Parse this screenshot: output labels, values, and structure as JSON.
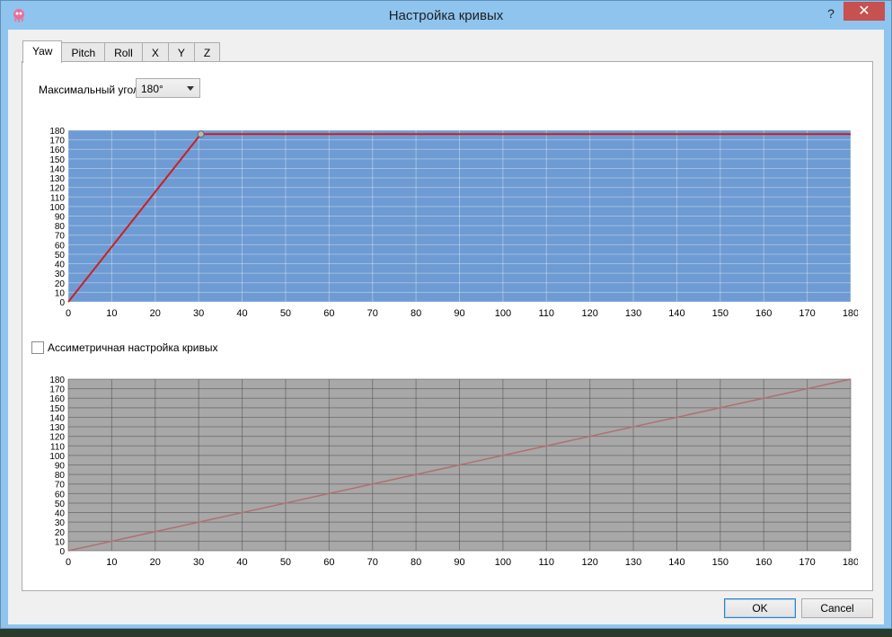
{
  "window": {
    "title": "Настройка кривых"
  },
  "titlebar": {
    "help": "?",
    "close": "✕"
  },
  "tabs": [
    "Yaw",
    "Pitch",
    "Roll",
    "X",
    "Y",
    "Z"
  ],
  "active_tab": "Yaw",
  "max_angle": {
    "label": "Максимальный угол",
    "value": "180°"
  },
  "asymmetric": {
    "label": "Ассиметричная настройка кривых",
    "checked": false
  },
  "buttons": {
    "ok": "OK",
    "cancel": "Cancel"
  },
  "colors": {
    "top_plot_bg": "#6e9bd3",
    "bottom_plot_bg": "#a8a8a8",
    "top_line": "#cc1f1f",
    "bottom_line": "#b07070"
  },
  "chart_data": [
    {
      "type": "line",
      "x_ticks": [
        0,
        10,
        20,
        30,
        40,
        50,
        60,
        70,
        80,
        90,
        100,
        110,
        120,
        130,
        140,
        150,
        160,
        170,
        180
      ],
      "y_ticks": [
        0,
        10,
        20,
        30,
        40,
        50,
        60,
        70,
        80,
        90,
        100,
        110,
        120,
        130,
        140,
        150,
        160,
        170,
        180
      ],
      "xlim": [
        0,
        180
      ],
      "ylim": [
        0,
        180
      ],
      "grid": true,
      "series": [
        {
          "x": [
            0,
            30.5,
            180
          ],
          "y": [
            0,
            176,
            176
          ]
        }
      ],
      "control_points": [
        {
          "x": 30.5,
          "y": 176
        }
      ]
    },
    {
      "type": "line",
      "x_ticks": [
        0,
        10,
        20,
        30,
        40,
        50,
        60,
        70,
        80,
        90,
        100,
        110,
        120,
        130,
        140,
        150,
        160,
        170,
        180
      ],
      "y_ticks": [
        0,
        10,
        20,
        30,
        40,
        50,
        60,
        70,
        80,
        90,
        100,
        110,
        120,
        130,
        140,
        150,
        160,
        170,
        180
      ],
      "xlim": [
        0,
        180
      ],
      "ylim": [
        0,
        180
      ],
      "grid": true,
      "series": [
        {
          "x": [
            0,
            180
          ],
          "y": [
            0,
            180
          ]
        }
      ]
    }
  ]
}
